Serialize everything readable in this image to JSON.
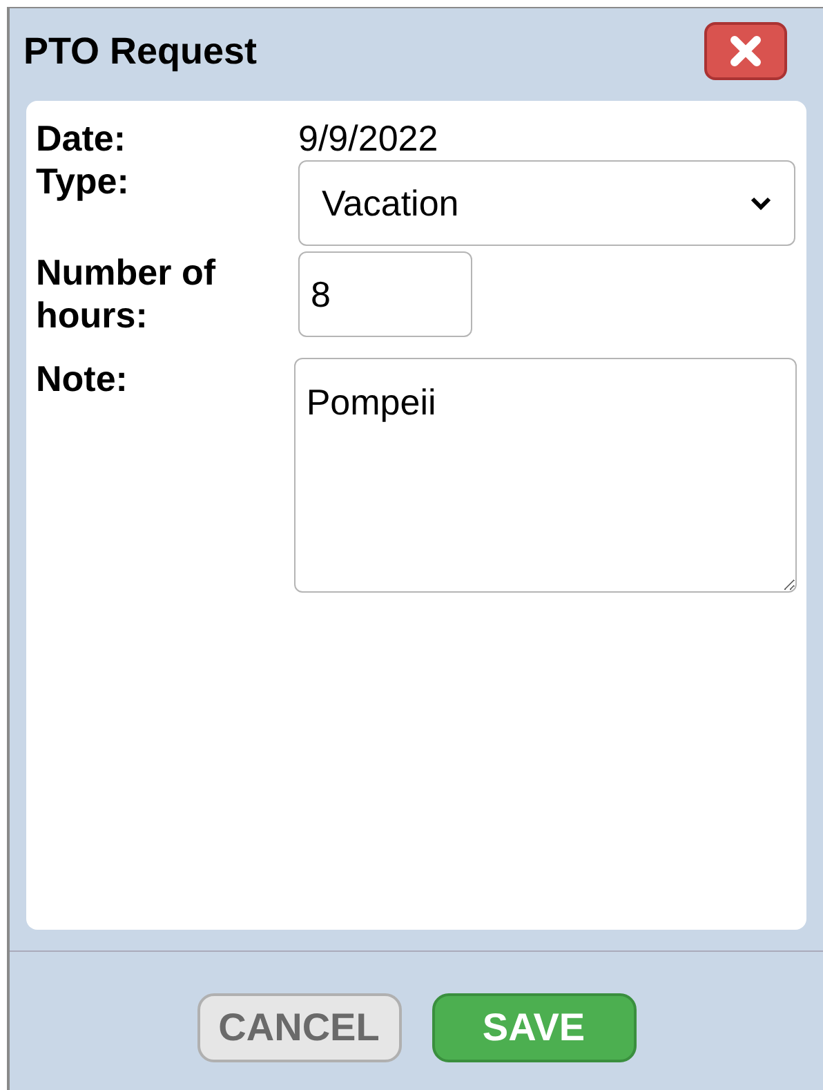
{
  "window": {
    "title": "PTO Request"
  },
  "fields": [
    {
      "kind": "text",
      "label": "Date:",
      "value": "9/9/2022"
    },
    {
      "kind": "select",
      "label": "Type:",
      "value": "Vacation"
    },
    {
      "kind": "input",
      "label": "Number of hours:",
      "value": "8"
    },
    {
      "kind": "textarea",
      "label": "Note:",
      "value": "Pompeii"
    }
  ],
  "buttons": [
    {
      "kind": "cancel",
      "label": "CANCEL"
    },
    {
      "kind": "save",
      "label": "SAVE"
    }
  ]
}
